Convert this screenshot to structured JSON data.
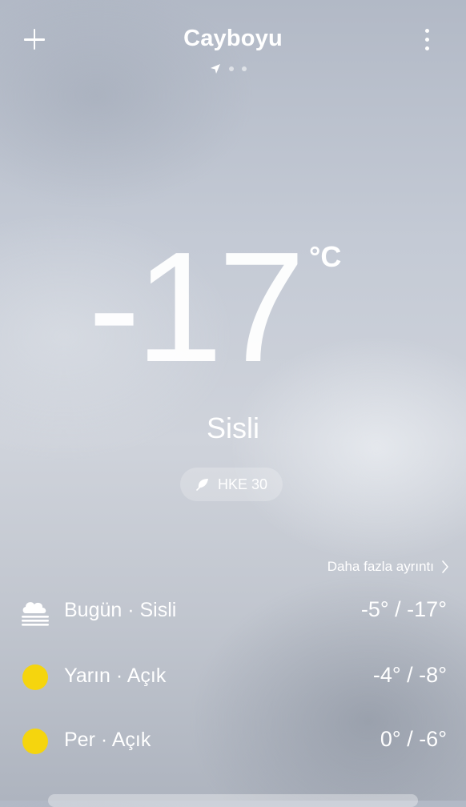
{
  "header": {
    "city": "Cayboyu",
    "page_count": 3,
    "current_page": 1
  },
  "current": {
    "temperature": "-17",
    "unit": "°C",
    "condition": "Sisli",
    "aqi_label": "HKE 30"
  },
  "details_link": "Daha fazla ayrıntı",
  "forecast": [
    {
      "label": "Bugün · Sisli",
      "icon": "fog-icon",
      "range": "-5° / -17°"
    },
    {
      "label": "Yarın · Açık",
      "icon": "sun-icon",
      "range": "-4° / -8°"
    },
    {
      "label": "Per · Açık",
      "icon": "sun-icon",
      "range": "0° / -6°"
    }
  ],
  "colors": {
    "sun": "#f5d50e",
    "text": "#ffffff"
  }
}
